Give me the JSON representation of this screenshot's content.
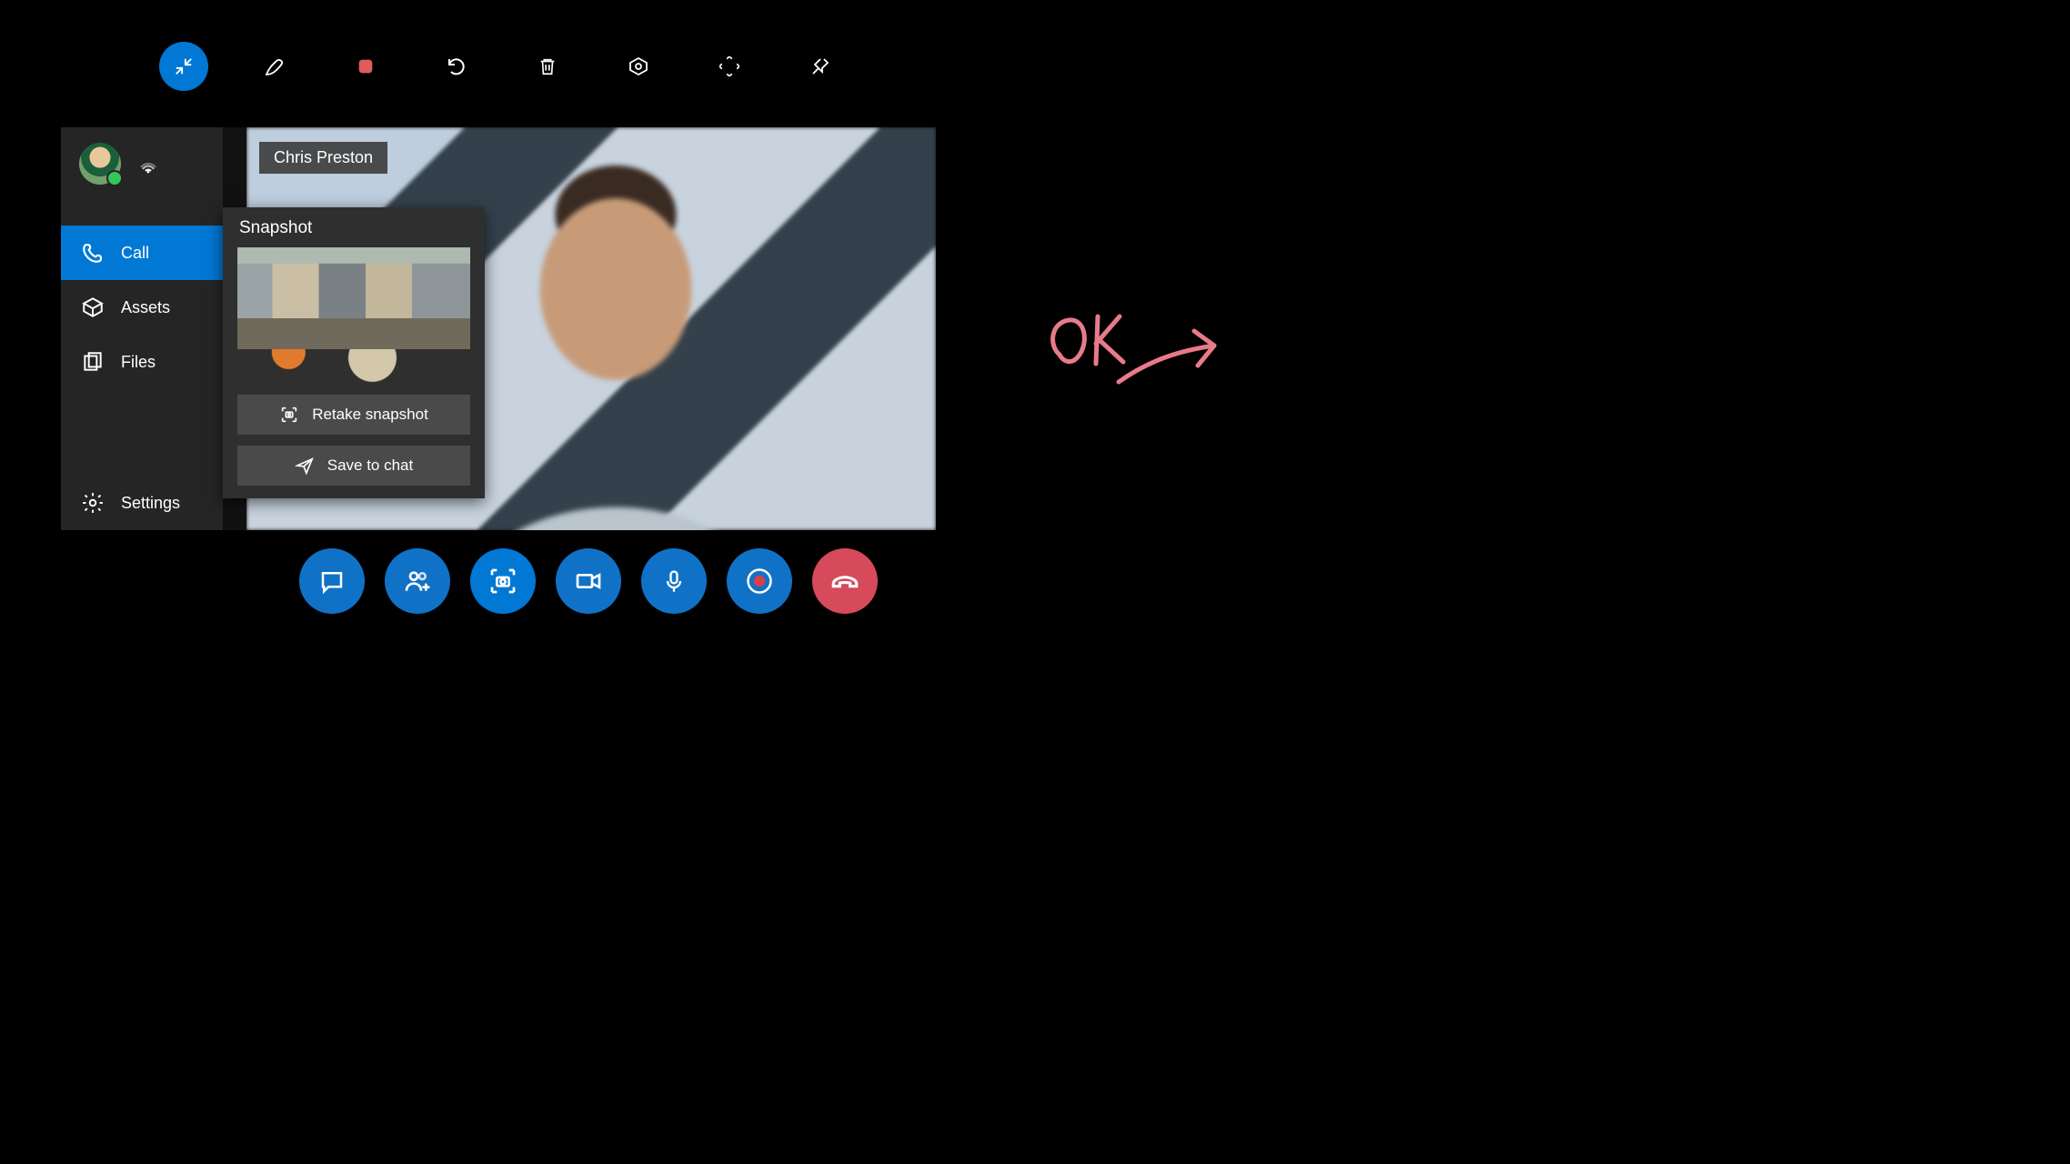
{
  "toolbar": {
    "items": [
      {
        "name": "collapse-icon",
        "active": true
      },
      {
        "name": "pen-icon",
        "active": false
      },
      {
        "name": "stop-icon",
        "active": false
      },
      {
        "name": "undo-icon",
        "active": false
      },
      {
        "name": "trash-icon",
        "active": false
      },
      {
        "name": "target-icon",
        "active": false
      },
      {
        "name": "fullscreen-icon",
        "active": false
      },
      {
        "name": "pin-icon",
        "active": false
      }
    ]
  },
  "sidebar": {
    "items": [
      {
        "name": "call",
        "label": "Call",
        "active": true
      },
      {
        "name": "assets",
        "label": "Assets",
        "active": false
      },
      {
        "name": "files",
        "label": "Files",
        "active": false
      }
    ],
    "settings_label": "Settings"
  },
  "call": {
    "caller_name": "Chris Preston"
  },
  "snapshot": {
    "title": "Snapshot",
    "retake_label": "Retake snapshot",
    "save_label": "Save to chat"
  },
  "controls": {
    "items": [
      {
        "name": "chat-button"
      },
      {
        "name": "add-people-button"
      },
      {
        "name": "snapshot-button"
      },
      {
        "name": "video-button"
      },
      {
        "name": "mic-button"
      },
      {
        "name": "record-button"
      },
      {
        "name": "hangup-button"
      }
    ]
  },
  "annotation": {
    "text": "OK",
    "color": "#e97a8a"
  }
}
